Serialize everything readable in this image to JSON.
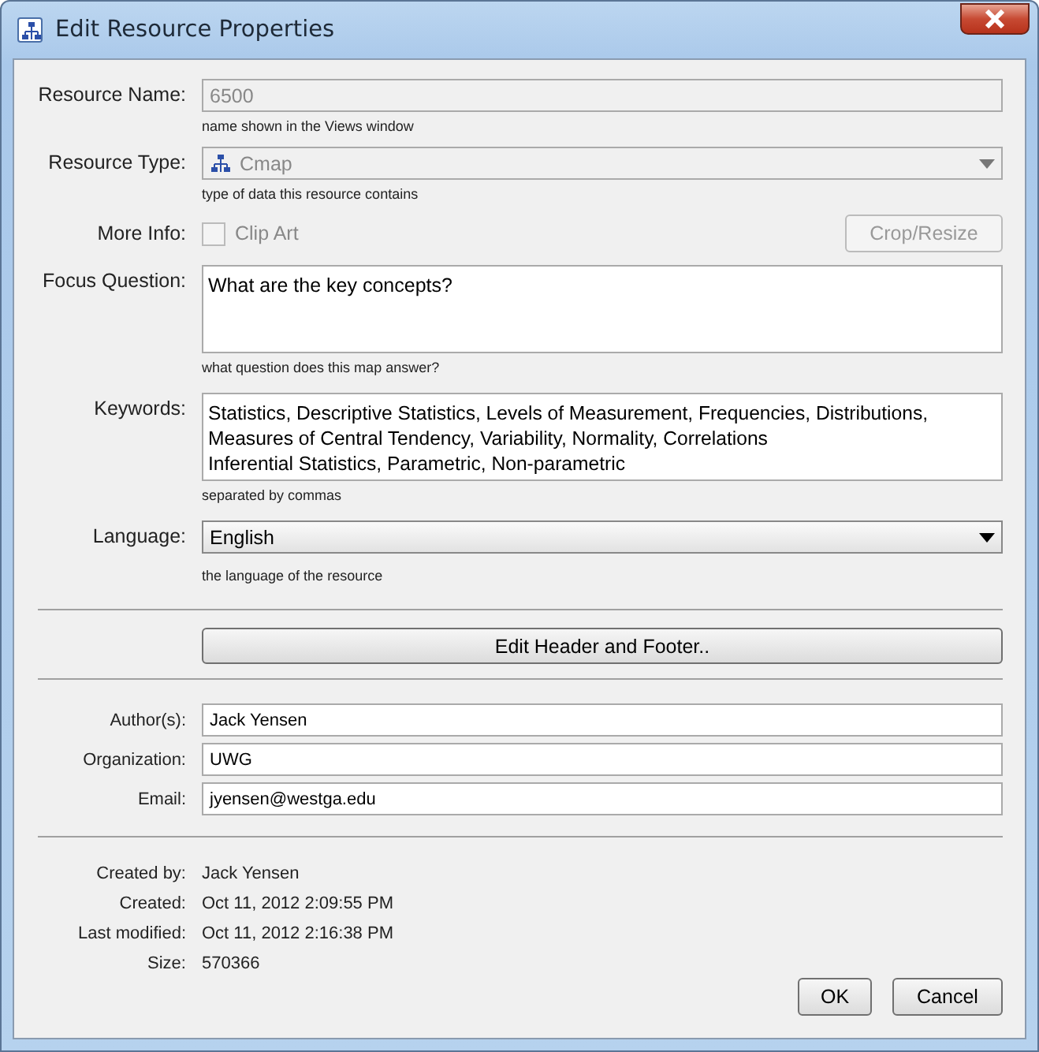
{
  "window": {
    "title": "Edit Resource Properties"
  },
  "resource_name": {
    "label": "Resource Name:",
    "value": "6500",
    "disabled": true,
    "hint": "name shown in the Views window"
  },
  "resource_type": {
    "label": "Resource Type:",
    "value": "Cmap",
    "disabled": true,
    "hint": "type of data this resource contains"
  },
  "more_info": {
    "label": "More Info:",
    "checkbox": {
      "label": "Clip Art",
      "checked": false,
      "disabled": true
    },
    "button": {
      "label": "Crop/Resize",
      "disabled": true
    }
  },
  "focus_question": {
    "label": "Focus Question:",
    "value": "What are the key concepts?",
    "hint": "what question does this map answer?"
  },
  "keywords": {
    "label": "Keywords:",
    "lines": [
      "Statistics, Descriptive Statistics, Levels of Measurement, Frequencies, Distributions,",
      "Measures of Central Tendency, Variability, Normality, Correlations",
      "Inferential Statistics, Parametric, Non-parametric"
    ],
    "hint": "separated by commas"
  },
  "language": {
    "label": "Language:",
    "value": "English",
    "hint": "the language of the resource"
  },
  "header_footer_button": "Edit Header and Footer..",
  "contact_fields": [
    {
      "label": "Author(s):",
      "value": "Jack Yensen"
    },
    {
      "label": "Organization:",
      "value": "UWG"
    },
    {
      "label": "Email:",
      "value": "jyensen@westga.edu"
    }
  ],
  "info": [
    {
      "label": "Created by:",
      "value": "Jack Yensen"
    },
    {
      "label": "Created:",
      "value": "Oct 11, 2012 2:09:55 PM"
    },
    {
      "label": "Last modified:",
      "value": "Oct 11, 2012 2:16:38 PM"
    },
    {
      "label": "Size:",
      "value": "570366"
    }
  ],
  "buttons": [
    "OK",
    "Cancel"
  ]
}
